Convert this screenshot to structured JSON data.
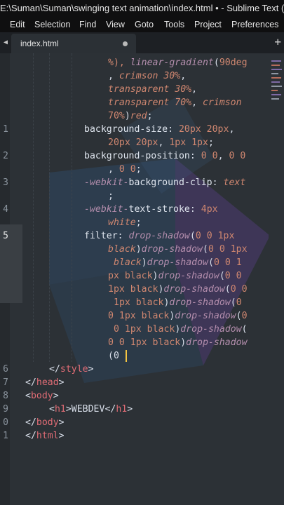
{
  "window": {
    "title": "E:\\Suman\\Suman\\swinging text animation\\index.html • - Sublime Text (UNI"
  },
  "menu": [
    "Edit",
    "Selection",
    "Find",
    "View",
    "Goto",
    "Tools",
    "Project",
    "Preferences"
  ],
  "tabs": [
    {
      "label": "index.html",
      "modified": true
    }
  ],
  "editor": {
    "line_numbers": {
      "l11": "1",
      "l12": "2",
      "l13": "3",
      "l14": "4",
      "l15": "5",
      "l16": "6",
      "l17": "7",
      "l18": "8",
      "l19": "9",
      "l20": "0",
      "l21": "1"
    },
    "code": {
      "c0a": "%), ",
      "c0b": "linear-gradient",
      "c0c": "(",
      "c0d": "90deg",
      "c1a": ", ",
      "c1b": "crimson 30%",
      "c1c": ",",
      "c2a": "transparent 30%",
      "c2b": ",",
      "c3a": "transparent 70%",
      "c3b": ", ",
      "c3c": "crimson",
      "c4a": "70%",
      "c4b": ")",
      "c4c": "red",
      "c4d": ";",
      "c5a": "background-size",
      "c5b": ": ",
      "c5c": "20px 20px",
      "c5d": ",",
      "c6a": "20px 20px",
      "c6b": ", ",
      "c6c": "1px 1px",
      "c6d": ";",
      "c7a": "background-position",
      "c7b": ": ",
      "c7c": "0 0",
      "c7d": ", ",
      "c7e": "0 0",
      "c8a": ", ",
      "c8b": "0 0",
      "c8c": ";",
      "c9a": "-webkit-",
      "c9b": "background-clip",
      "c9c": ": ",
      "c9d": "text",
      "c10a": ";",
      "c11a": "-webkit-",
      "c11b": "text-stroke",
      "c11c": ": ",
      "c11d": "4px",
      "c12a": "white",
      "c12b": ";",
      "c13a": "filter",
      "c13b": ": ",
      "c13c": "drop-shadow",
      "c13d": "(",
      "c13e": "0 0 1px",
      "c14a": "black",
      "c14b": ")",
      "c14c": "drop-shadow",
      "c14d": "(",
      "c14e": "0 0 1px",
      "c15a": "black",
      "c15b": ")",
      "c15c": "drop-shadow",
      "c15d": "(",
      "c15e": "0 0 1",
      "c16a": "px black",
      "c16b": ")",
      "c16c": "drop-shadow",
      "c16d": "(",
      "c16e": "0 0",
      "c17a": "1px black",
      "c17b": ")",
      "c17c": "drop-shadow",
      "c17d": "(",
      "c17e": "0 0",
      "c18a": "1px black",
      "c18b": ")",
      "c18c": "drop-shadow",
      "c18d": "(",
      "c18e": "0",
      "c19a": "0 1px black",
      "c19b": ")",
      "c19c": "drop-shadow",
      "c19d": "(",
      "c19e": "0",
      "c20a": "0 1px black",
      "c20b": ")",
      "c20c": "drop-shadow",
      "c20d": "(",
      "c21a": "0 0 1px black",
      "c21b": ")",
      "c21c": "drop-shadow",
      "c22a": "(0",
      "c23a": "</",
      "c23b": "style",
      "c23c": ">",
      "c24a": "</",
      "c24b": "head",
      "c24c": ">",
      "c25a": "<",
      "c25b": "body",
      "c25c": ">",
      "c26a": "<",
      "c26b": "h1",
      "c26c": ">",
      "c26d": "WEBDEV",
      "c26e": "</",
      "c26f": "h1",
      "c26g": ">",
      "c27a": "</",
      "c27b": "body",
      "c27c": ">",
      "c28a": "</",
      "c28b": "html",
      "c28c": ">"
    }
  },
  "colors": {
    "background": "#2c3136",
    "function": "#b48ead",
    "number": "#d08770",
    "tag": "#e06c75",
    "cursor": "#f5c542"
  }
}
